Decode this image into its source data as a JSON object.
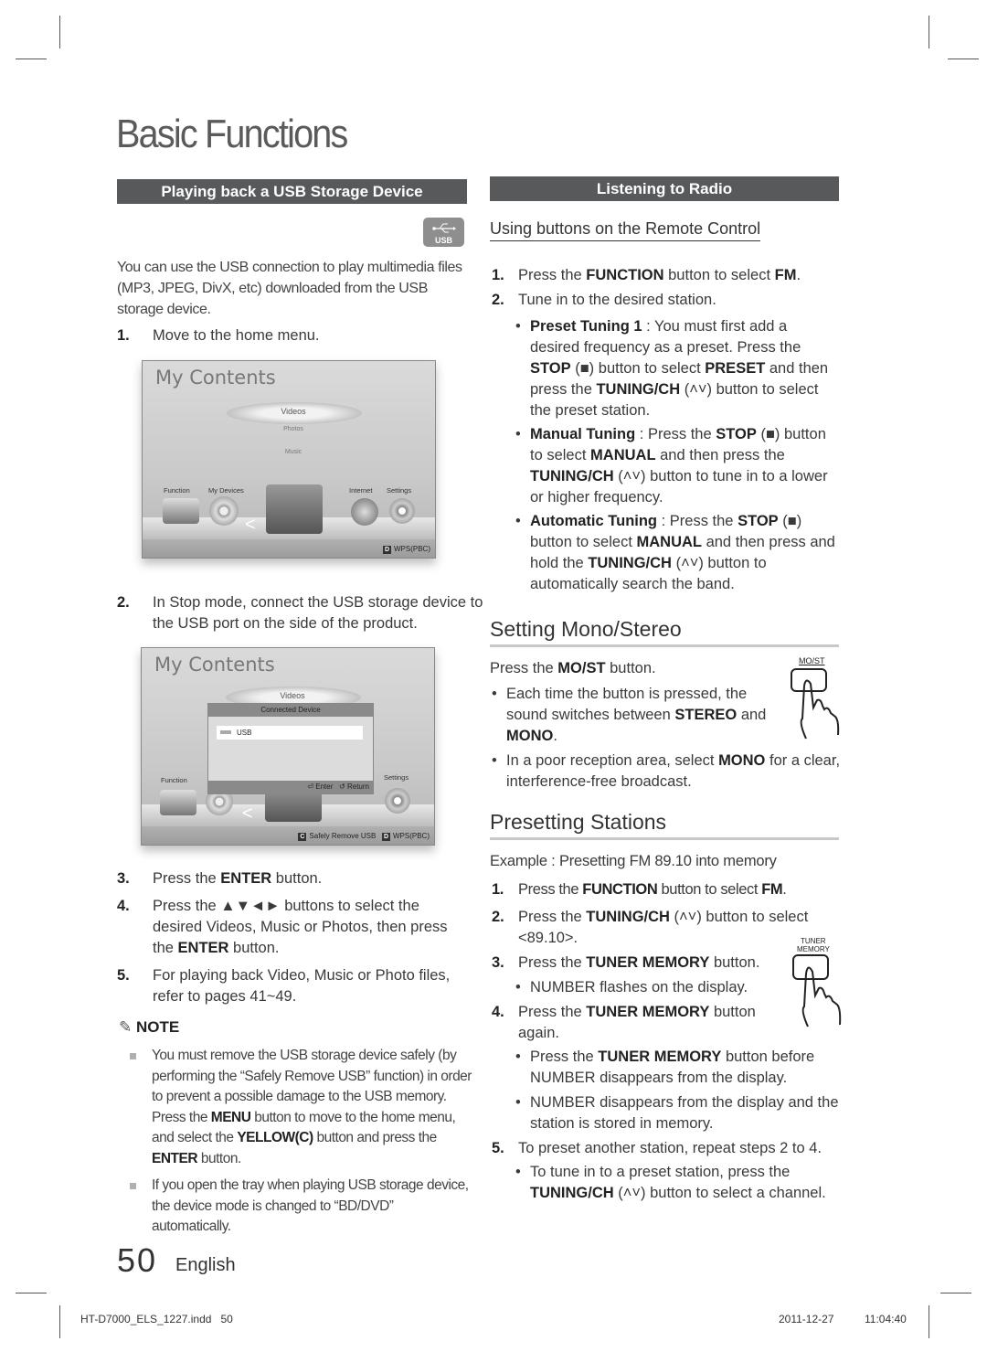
{
  "page": {
    "title": "Basic Functions",
    "page_number": "50",
    "language": "English",
    "footer_file": "HT-D7000_ELS_1227.indd   50",
    "footer_date": "2011-12-27",
    "footer_time": "11:04:40"
  },
  "left": {
    "section_title": "Playing back a USB Storage Device",
    "usb_badge": "USB",
    "intro": "You can use the USB connection to play multimedia files (MP3, JPEG, DivX, etc) downloaded from the USB storage device.",
    "steps": [
      {
        "num": "1.",
        "text": "Move to the home menu."
      },
      {
        "num": "2.",
        "text": "In Stop mode, connect the USB storage device to the USB port on the side of the product."
      },
      {
        "num": "3.",
        "pre": "Press the ",
        "bold": "ENTER",
        "post": " button."
      },
      {
        "num": "4.",
        "pre": "Press the ▲▼◄► buttons to select the desired Videos, Music or Photos, then press the ",
        "bold": "ENTER",
        "post": " button."
      },
      {
        "num": "5.",
        "text": "For playing back Video, Music or Photo files, refer to pages 41~49."
      }
    ],
    "screen1": {
      "title": "My Contents",
      "menu": [
        "Videos",
        "Photos",
        "Music"
      ],
      "icons": [
        "Function",
        "My Devices",
        "Internet",
        "Settings"
      ],
      "footer_key": "D",
      "footer_label": "WPS(PBC)"
    },
    "screen2": {
      "title": "My Contents",
      "menu_top": "Videos",
      "dialog_title": "Connected Device",
      "dialog_item": "USB",
      "dialog_enter": "Enter",
      "dialog_return": "Return",
      "icons": [
        "Function",
        "Settings"
      ],
      "footer_keys": [
        {
          "key": "C",
          "label": "Safely Remove USB"
        },
        {
          "key": "D",
          "label": "WPS(PBC)"
        }
      ]
    },
    "note": {
      "heading": "NOTE",
      "items": [
        {
          "parts": [
            {
              "t": "You must remove the USB storage device safely (by performing the “Safely Remove USB” function) in order to prevent a possible damage to the USB memory. Press the "
            },
            {
              "b": "MENU"
            },
            {
              "t": " button to move to the home menu, and select the "
            },
            {
              "b": "YELLOW(C)"
            },
            {
              "t": " button and press the "
            },
            {
              "b": "ENTER"
            },
            {
              "t": " button."
            }
          ]
        },
        {
          "parts": [
            {
              "t": "If you open the tray when playing USB storage device, the device mode is changed to “BD/DVD” automatically."
            }
          ]
        }
      ]
    }
  },
  "right": {
    "section_title": "Listening to Radio",
    "subhead": "Using buttons on the Remote Control",
    "steps": [
      {
        "num": "1.",
        "parts": [
          {
            "t": "Press the "
          },
          {
            "b": "FUNCTION"
          },
          {
            "t": " button to select "
          },
          {
            "b": "FM"
          },
          {
            "t": "."
          }
        ]
      },
      {
        "num": "2.",
        "parts": [
          {
            "t": "Tune in to the desired station."
          }
        ]
      }
    ],
    "bullets": [
      {
        "parts": [
          {
            "b": "Preset Tuning 1"
          },
          {
            "t": " : You must first add a desired frequency as a preset. Press the "
          },
          {
            "b": "STOP"
          },
          {
            "t": " (■) button to select "
          },
          {
            "b": "PRESET"
          },
          {
            "t": " and then press the "
          },
          {
            "b": "TUNING/CH"
          },
          {
            "t": " (˄˅) button to select the preset station."
          }
        ]
      },
      {
        "parts": [
          {
            "b": "Manual Tuning"
          },
          {
            "t": " : Press the "
          },
          {
            "b": "STOP"
          },
          {
            "t": " (■) button to select "
          },
          {
            "b": "MANUAL"
          },
          {
            "t": " and then press the "
          },
          {
            "b": "TUNING/CH"
          },
          {
            "t": " (˄˅) button to tune in to a lower or higher frequency."
          }
        ]
      },
      {
        "parts": [
          {
            "b": "Automatic Tuning"
          },
          {
            "t": " : Press the "
          },
          {
            "b": "STOP"
          },
          {
            "t": " (■) button to select "
          },
          {
            "b": "MANUAL"
          },
          {
            "t": " and then press and hold the "
          },
          {
            "b": "TUNING/CH"
          },
          {
            "t": " (˄˅) button to automatically search the band."
          }
        ]
      }
    ],
    "mono": {
      "heading": "Setting Mono/Stereo",
      "button_label": "MO/ST",
      "intro_parts": [
        {
          "t": "Press the "
        },
        {
          "b": "MO/ST"
        },
        {
          "t": " button."
        }
      ],
      "bullets": [
        {
          "parts": [
            {
              "t": "Each time the button is pressed, the sound switches between "
            },
            {
              "b": "STEREO"
            },
            {
              "t": " and "
            },
            {
              "b": "MONO"
            },
            {
              "t": "."
            }
          ]
        },
        {
          "parts": [
            {
              "t": "In a poor reception area, select "
            },
            {
              "b": "MONO"
            },
            {
              "t": " for a clear, interference-free broadcast."
            }
          ]
        }
      ]
    },
    "preset": {
      "heading": "Presetting Stations",
      "button_label_1": "TUNER",
      "button_label_2": "MEMORY",
      "example": "Example : Presetting FM 89.10 into memory",
      "steps": [
        {
          "num": "1.",
          "parts": [
            {
              "t": "Press the "
            },
            {
              "b": "FUNCTION"
            },
            {
              "t": " button to select "
            },
            {
              "b": "FM"
            },
            {
              "t": "."
            }
          ]
        },
        {
          "num": "2.",
          "parts": [
            {
              "t": "Press the "
            },
            {
              "b": "TUNING/CH"
            },
            {
              "t": " (˄˅) button to select <89.10>."
            }
          ]
        },
        {
          "num": "3.",
          "parts": [
            {
              "t": "Press the "
            },
            {
              "b": "TUNER MEMORY"
            },
            {
              "t": " button."
            }
          ],
          "bullets": [
            {
              "parts": [
                {
                  "t": "NUMBER flashes on the display."
                }
              ]
            }
          ]
        },
        {
          "num": "4.",
          "parts": [
            {
              "t": "Press the "
            },
            {
              "b": "TUNER MEMORY"
            },
            {
              "t": " button again."
            }
          ],
          "bullets": [
            {
              "parts": [
                {
                  "t": "Press the "
                },
                {
                  "b": "TUNER MEMORY"
                },
                {
                  "t": " button before NUMBER disappears from the display."
                }
              ]
            },
            {
              "parts": [
                {
                  "t": "NUMBER disappears from the display and the station is stored in memory."
                }
              ]
            }
          ]
        },
        {
          "num": "5.",
          "parts": [
            {
              "t": "To preset another station, repeat steps 2 to 4."
            }
          ],
          "bullets": [
            {
              "parts": [
                {
                  "t": "To tune in to a preset station, press the "
                },
                {
                  "b": "TUNING/CH"
                },
                {
                  "t": " (˄˅) button to select a channel."
                }
              ]
            }
          ]
        }
      ]
    }
  }
}
